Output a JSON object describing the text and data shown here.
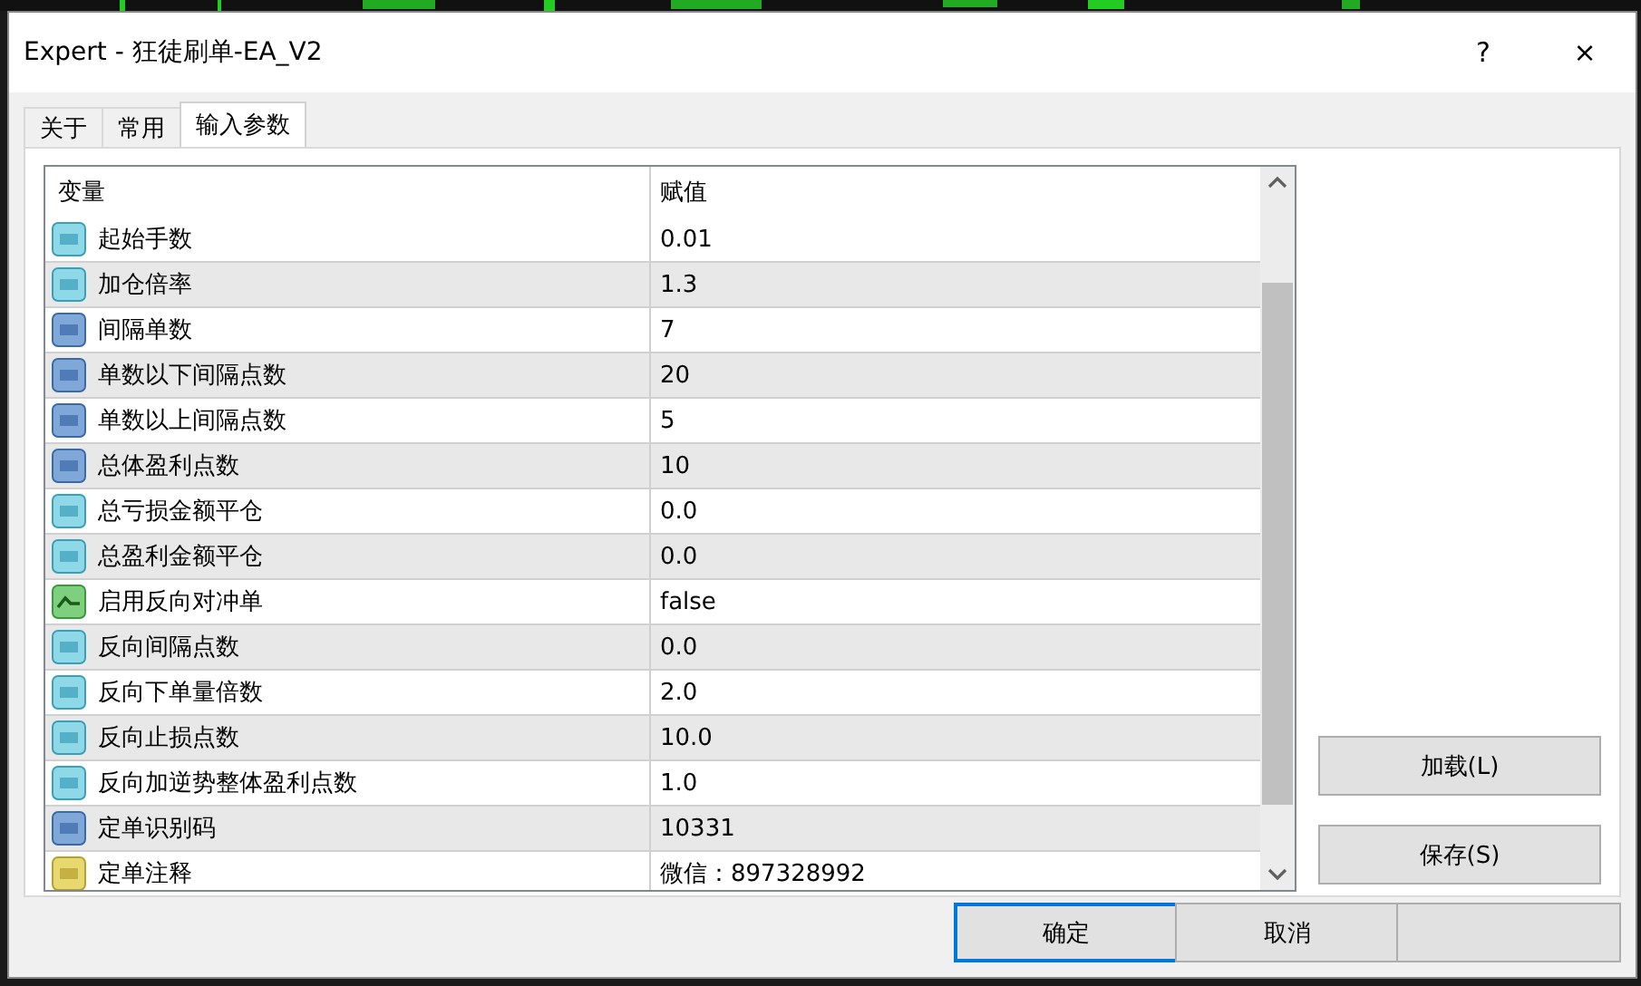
{
  "window": {
    "title": "Expert - 狂徒刷单-EA_V2",
    "help": "?",
    "close": "×"
  },
  "tabs": [
    {
      "label": "关于",
      "selected": false
    },
    {
      "label": "常用",
      "selected": false
    },
    {
      "label": "输入参数",
      "selected": true
    }
  ],
  "table": {
    "columns": [
      "变量",
      "赋值"
    ],
    "rows": [
      {
        "kind": "double",
        "name": "起始手数",
        "value": "0.01"
      },
      {
        "kind": "double",
        "name": "加仓倍率",
        "value": "1.3"
      },
      {
        "kind": "int",
        "name": "间隔单数",
        "value": "7"
      },
      {
        "kind": "int",
        "name": "单数以下间隔点数",
        "value": "20"
      },
      {
        "kind": "int",
        "name": "单数以上间隔点数",
        "value": "5"
      },
      {
        "kind": "int",
        "name": "总体盈利点数",
        "value": "10"
      },
      {
        "kind": "double",
        "name": "总亏损金额平仓",
        "value": "0.0"
      },
      {
        "kind": "double",
        "name": "总盈利金额平仓",
        "value": "0.0"
      },
      {
        "kind": "bool",
        "name": "启用反向对冲单",
        "value": "false"
      },
      {
        "kind": "double",
        "name": "反向间隔点数",
        "value": "0.0"
      },
      {
        "kind": "double",
        "name": "反向下单量倍数",
        "value": "2.0"
      },
      {
        "kind": "double",
        "name": "反向止损点数",
        "value": "10.0"
      },
      {
        "kind": "double",
        "name": "反向加逆势整体盈利点数",
        "value": "1.0"
      },
      {
        "kind": "int",
        "name": "定单识别码",
        "value": "10331"
      },
      {
        "kind": "string",
        "name": "定单注释",
        "value": "微信：897328992"
      }
    ]
  },
  "side_buttons": [
    "加载(L)",
    "保存(S)"
  ],
  "bottom_buttons": [
    {
      "label": "确定",
      "selected": true
    },
    {
      "label": "取消",
      "selected": false
    },
    {
      "selected": false
    }
  ]
}
